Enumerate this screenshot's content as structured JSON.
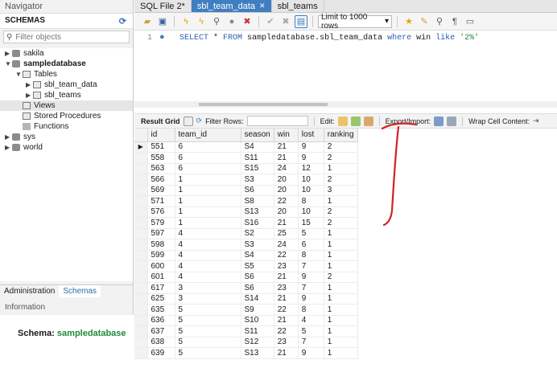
{
  "navigator": {
    "title": "Navigator",
    "schemas_label": "SCHEMAS",
    "filter_placeholder": "Filter objects",
    "tree": [
      {
        "label": "sakila",
        "level": 0,
        "type": "db",
        "expanded": false,
        "bold": false
      },
      {
        "label": "sampledatabase",
        "level": 0,
        "type": "db",
        "expanded": true,
        "bold": true
      },
      {
        "label": "Tables",
        "level": 1,
        "type": "table",
        "expanded": true,
        "bold": false
      },
      {
        "label": "sbl_team_data",
        "level": 2,
        "type": "table",
        "expanded": false,
        "bold": false
      },
      {
        "label": "sbl_teams",
        "level": 2,
        "type": "table",
        "expanded": false,
        "bold": false
      },
      {
        "label": "Views",
        "level": 1,
        "type": "table",
        "expanded": null,
        "bold": false,
        "selected": true
      },
      {
        "label": "Stored Procedures",
        "level": 1,
        "type": "table",
        "expanded": null,
        "bold": false
      },
      {
        "label": "Functions",
        "level": 1,
        "type": "fn",
        "expanded": null,
        "bold": false
      },
      {
        "label": "sys",
        "level": 0,
        "type": "db",
        "expanded": false,
        "bold": false
      },
      {
        "label": "world",
        "level": 0,
        "type": "db",
        "expanded": false,
        "bold": false
      }
    ],
    "bottom_tabs": [
      "Administration",
      "Schemas"
    ],
    "info_title": "Information",
    "schema_prefix": "Schema:",
    "schema_name": "sampledatabase"
  },
  "tabs": [
    {
      "label": "SQL File 2*",
      "active": false
    },
    {
      "label": "sbl_team_data",
      "active": true
    },
    {
      "label": "sbl_teams",
      "active": false
    }
  ],
  "toolbar": {
    "limit_label": "Limit to 1000 rows"
  },
  "editor": {
    "line_number": "1",
    "tokens": [
      {
        "t": "SELECT",
        "k": "kw"
      },
      {
        "t": " * ",
        "k": ""
      },
      {
        "t": "FROM",
        "k": "kw"
      },
      {
        "t": " sampledatabase.sbl_team_data ",
        "k": ""
      },
      {
        "t": "where",
        "k": "kw"
      },
      {
        "t": " win ",
        "k": ""
      },
      {
        "t": "like",
        "k": "kw"
      },
      {
        "t": " ",
        "k": ""
      },
      {
        "t": "'2%'",
        "k": "str"
      }
    ]
  },
  "result_toolbar": {
    "result_grid": "Result Grid",
    "filter_rows": "Filter Rows:",
    "edit": "Edit:",
    "export_import": "Export/Import:",
    "wrap": "Wrap Cell Content:"
  },
  "grid": {
    "columns": [
      "id",
      "team_id",
      "season",
      "win",
      "lost",
      "ranking"
    ],
    "rows": [
      [
        "551",
        "6",
        "S4",
        "21",
        "9",
        "2"
      ],
      [
        "558",
        "6",
        "S11",
        "21",
        "9",
        "2"
      ],
      [
        "563",
        "6",
        "S15",
        "24",
        "12",
        "1"
      ],
      [
        "566",
        "1",
        "S3",
        "20",
        "10",
        "2"
      ],
      [
        "569",
        "1",
        "S6",
        "20",
        "10",
        "3"
      ],
      [
        "571",
        "1",
        "S8",
        "22",
        "8",
        "1"
      ],
      [
        "576",
        "1",
        "S13",
        "20",
        "10",
        "2"
      ],
      [
        "579",
        "1",
        "S16",
        "21",
        "15",
        "2"
      ],
      [
        "597",
        "4",
        "S2",
        "25",
        "5",
        "1"
      ],
      [
        "598",
        "4",
        "S3",
        "24",
        "6",
        "1"
      ],
      [
        "599",
        "4",
        "S4",
        "22",
        "8",
        "1"
      ],
      [
        "600",
        "4",
        "S5",
        "23",
        "7",
        "1"
      ],
      [
        "601",
        "4",
        "S6",
        "21",
        "9",
        "2"
      ],
      [
        "617",
        "3",
        "S6",
        "23",
        "7",
        "1"
      ],
      [
        "625",
        "3",
        "S14",
        "21",
        "9",
        "1"
      ],
      [
        "635",
        "5",
        "S9",
        "22",
        "8",
        "1"
      ],
      [
        "636",
        "5",
        "S10",
        "21",
        "4",
        "1"
      ],
      [
        "637",
        "5",
        "S11",
        "22",
        "5",
        "1"
      ],
      [
        "638",
        "5",
        "S12",
        "23",
        "7",
        "1"
      ],
      [
        "639",
        "5",
        "S13",
        "21",
        "9",
        "1"
      ]
    ]
  },
  "colors": {
    "accent": "#3f7fc1",
    "annotation": "#d22222",
    "schema_name": "#1f8a3a"
  }
}
